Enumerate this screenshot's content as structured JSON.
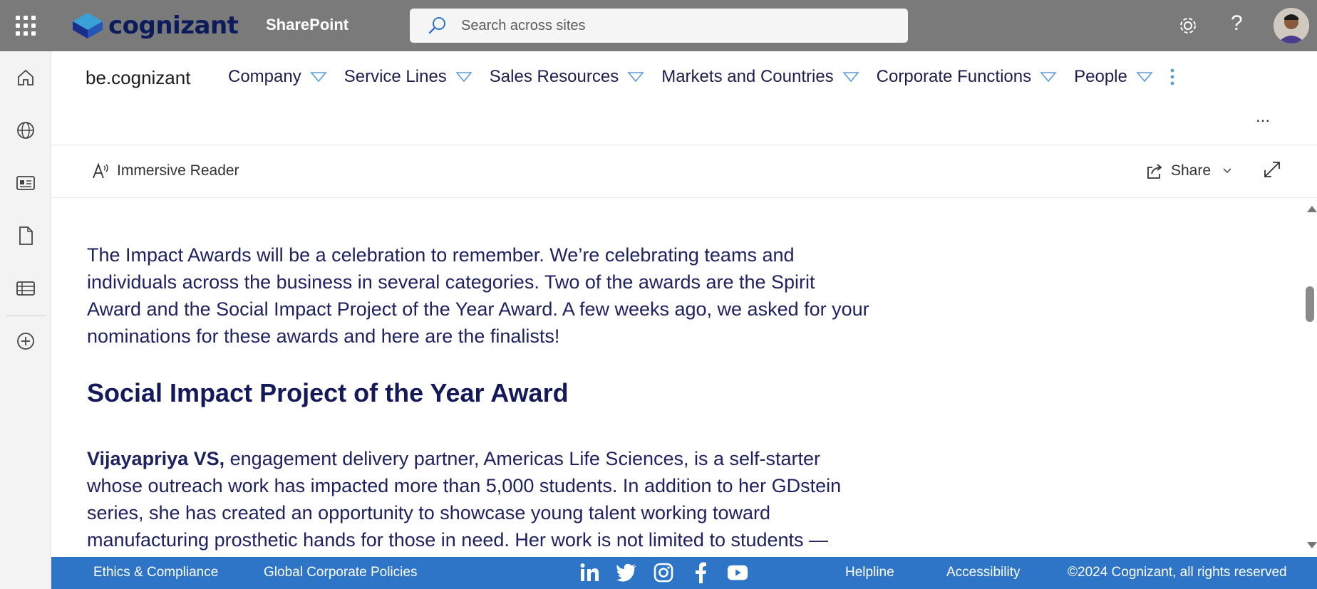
{
  "suitebar": {
    "brand": "cognizant",
    "app_name": "SharePoint",
    "search_placeholder": "Search across sites",
    "bg_color": "#7a7a7a"
  },
  "leftrail": {
    "items": [
      {
        "name": "home-icon"
      },
      {
        "name": "globe-icon"
      },
      {
        "name": "news-icon"
      },
      {
        "name": "file-icon"
      },
      {
        "name": "list-icon"
      },
      {
        "name": "add-circle-icon"
      }
    ]
  },
  "sitenav": {
    "site_name": "be.cognizant",
    "items": [
      {
        "label": "Company"
      },
      {
        "label": "Service Lines"
      },
      {
        "label": "Sales Resources"
      },
      {
        "label": "Markets and Countries"
      },
      {
        "label": "Corporate Functions"
      },
      {
        "label": "People"
      }
    ],
    "more_label": "..."
  },
  "cmdbar": {
    "reader_label": "Immersive Reader",
    "share_label": "Share"
  },
  "article": {
    "intro": "The Impact Awards will be a celebration to remember. We’re celebrating teams and individuals across the business in several categories. Two of the awards are the Spirit Award and the Social Impact Project of the Year Award. A few weeks ago, we asked for your nominations for these awards and here are the finalists!",
    "heading": "Social Impact Project of the Year Award",
    "finalist_name": "Vijayapriya VS,",
    "finalist_text": " engagement delivery partner, Americas Life Sciences, is a self-starter whose outreach work has impacted more than 5,000 students. In addition to her GDstein series, she has created an opportunity to showcase young talent working toward manufacturing prosthetic hands for those in need. Her work is not limited to students —"
  },
  "footer": {
    "bg_color": "#2e75c7",
    "ethics": "Ethics & Compliance",
    "policies": "Global Corporate Policies",
    "helpline": "Helpline",
    "accessibility": "Accessibility",
    "copyright": "©2024 Cognizant, all rights reserved",
    "social": [
      "linkedin-icon",
      "twitter-icon",
      "instagram-icon",
      "facebook-icon",
      "youtube-icon"
    ]
  }
}
